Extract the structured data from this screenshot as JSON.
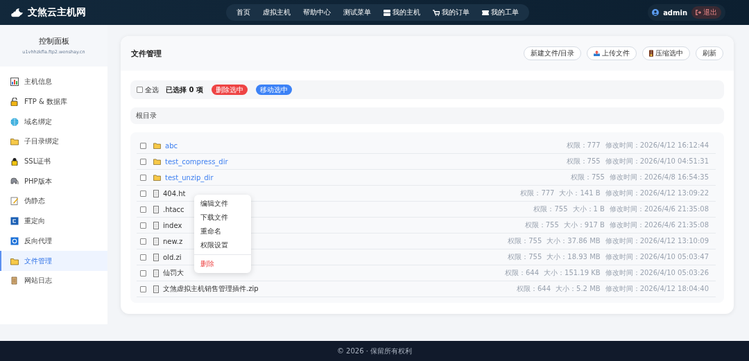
{
  "header": {
    "logo_text": "文煞云主机网",
    "nav": [
      "首页",
      "虚拟主机",
      "帮助中心",
      "测试菜单",
      "我的主机",
      "我的订单",
      "我的工单"
    ],
    "user": "admin",
    "logout": "退出"
  },
  "sidebar": {
    "title": "控制面板",
    "domain": "u1vhhzkfla.ftp2.wenshay.cn",
    "items": [
      {
        "label": "主机信息",
        "selected": false
      },
      {
        "label": "FTP & 数据库",
        "selected": false
      },
      {
        "label": "域名绑定",
        "selected": false
      },
      {
        "label": "子目录绑定",
        "selected": false
      },
      {
        "label": "SSL证书",
        "selected": false
      },
      {
        "label": "PHP版本",
        "selected": false
      },
      {
        "label": "伪静态",
        "selected": false
      },
      {
        "label": "重定向",
        "selected": false
      },
      {
        "label": "反向代理",
        "selected": false
      },
      {
        "label": "文件管理",
        "selected": true
      },
      {
        "label": "网站日志",
        "selected": false
      }
    ]
  },
  "panel": {
    "title": "文件管理",
    "actions": [
      "新建文件/目录",
      "上传文件",
      "压缩选中",
      "刷新"
    ],
    "toolbar": {
      "select_all": {
        "label": "全选",
        "checked": false
      },
      "selected_count": "已选择 0 项",
      "delete_selected": "删除选中",
      "move_selected": "移动选中"
    },
    "breadcrumb": "根目录",
    "files": [
      {
        "name": "abc",
        "kind": "folder",
        "checked": false,
        "meta": [
          "权限：777",
          "修改时间：2026/4/12 16:12:44"
        ]
      },
      {
        "name": "test_compress_dir",
        "kind": "folder",
        "checked": false,
        "meta": [
          "权限：755",
          "修改时间：2026/4/10 04:51:31"
        ]
      },
      {
        "name": "test_unzip_dir",
        "kind": "folder",
        "checked": false,
        "meta": [
          "权限：755",
          "修改时间：2026/4/8 16:54:35"
        ]
      },
      {
        "name": "404.ht",
        "kind": "file",
        "checked": false,
        "meta": [
          "权限：777",
          "大小：141 B",
          "修改时间：2026/4/12 13:09:22"
        ]
      },
      {
        "name": ".htacc",
        "kind": "file",
        "checked": false,
        "meta": [
          "权限：755",
          "大小：1 B",
          "修改时间：2026/4/6 21:35:08"
        ]
      },
      {
        "name": "index",
        "kind": "file",
        "checked": false,
        "meta": [
          "权限：755",
          "大小：917 B",
          "修改时间：2026/4/6 21:35:08"
        ]
      },
      {
        "name": "new.z",
        "kind": "file",
        "checked": false,
        "meta": [
          "权限：755",
          "大小：37.86 MB",
          "修改时间：2026/4/12 13:10:09"
        ]
      },
      {
        "name": "old.zi",
        "kind": "file",
        "checked": false,
        "meta": [
          "权限：755",
          "大小：18.93 MB",
          "修改时间：2026/4/10 05:03:47"
        ]
      },
      {
        "name": "仙罚大",
        "kind": "file",
        "checked": false,
        "meta": [
          "权限：644",
          "大小：151.19 KB",
          "修改时间：2026/4/10 05:03:26"
        ]
      },
      {
        "name": "文煞虚拟主机销售管理插件.zip",
        "kind": "file",
        "checked": false,
        "meta": [
          "权限：644",
          "大小：5.2 MB",
          "修改时间：2026/4/12 18:04:40"
        ]
      }
    ]
  },
  "context_menu": {
    "items": [
      {
        "label": "编辑文件",
        "kind": "normal"
      },
      {
        "label": "下载文件",
        "kind": "normal"
      },
      {
        "label": "重命名",
        "kind": "normal"
      },
      {
        "label": "权限设置",
        "kind": "normal"
      },
      {
        "label": "删除",
        "kind": "danger"
      }
    ]
  },
  "footer": "© 2026 · 保留所有权利"
}
